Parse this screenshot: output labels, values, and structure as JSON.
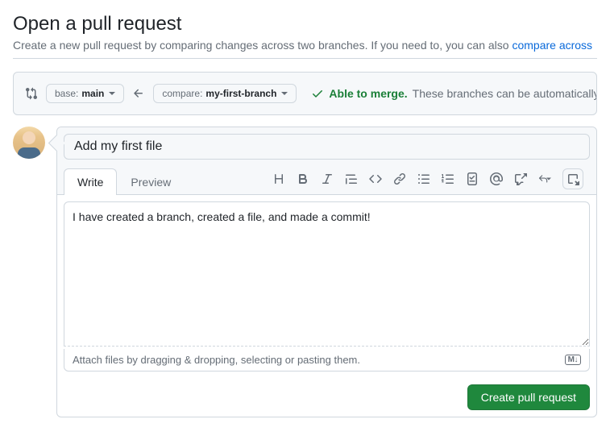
{
  "header": {
    "title": "Open a pull request",
    "subtitle_text": "Create a new pull request by comparing changes across two branches. If you need to, you can also ",
    "compare_link_text": "compare across"
  },
  "compare": {
    "base_label": "base:",
    "base_value": "main",
    "compare_label": "compare:",
    "compare_value": "my-first-branch",
    "merge_ok_text": "Able to merge.",
    "merge_rest_text": "These branches can be automatically"
  },
  "form": {
    "title_value": "Add my first file",
    "tabs": {
      "write": "Write",
      "preview": "Preview"
    },
    "body_value": "I have created a branch, created a file, and made a commit!",
    "attach_hint": "Attach files by dragging & dropping, selecting or pasting them.",
    "md_badge": "M↓",
    "submit_label": "Create pull request"
  }
}
